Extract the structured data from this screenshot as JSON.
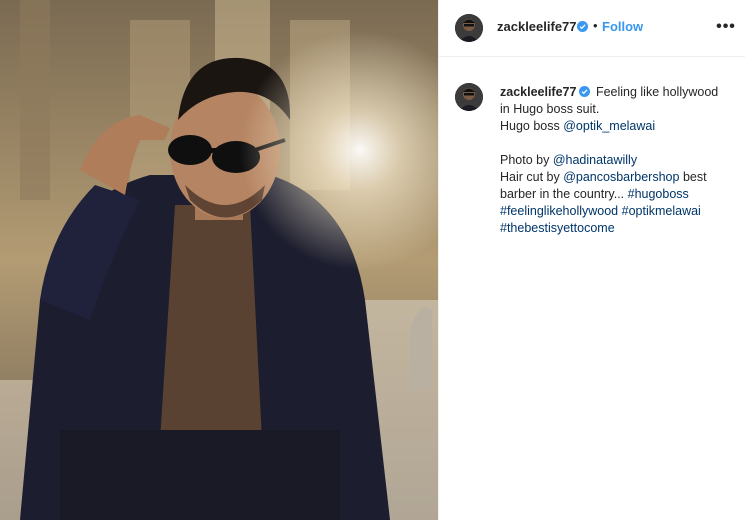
{
  "post": {
    "author": {
      "username": "zackleelife77",
      "verified": true,
      "avatar_icon": "profile-avatar"
    },
    "follow_label": "Follow",
    "separator": "•",
    "more_label": "•••",
    "caption": {
      "username": "zackleelife77",
      "line1": "Feeling like hollywood in Hugo boss suit.",
      "line2_text": "Hugo boss ",
      "line2_mention": "@optik_melawai",
      "line3_text": "Photo by ",
      "line3_mention": "@hadinatawilly",
      "line4_text": "Hair cut by ",
      "line4_mention": "@pancosbarbershop",
      "line4_rest": " best barber in the country... ",
      "hashtags": [
        "#hugoboss",
        "#feelinglikehollywood",
        "#optikmelawai",
        "#thebestisyettocome"
      ]
    },
    "colors": {
      "link": "#003569",
      "follow": "#3897f0",
      "verified": "#3897f0",
      "text": "#262626"
    }
  }
}
